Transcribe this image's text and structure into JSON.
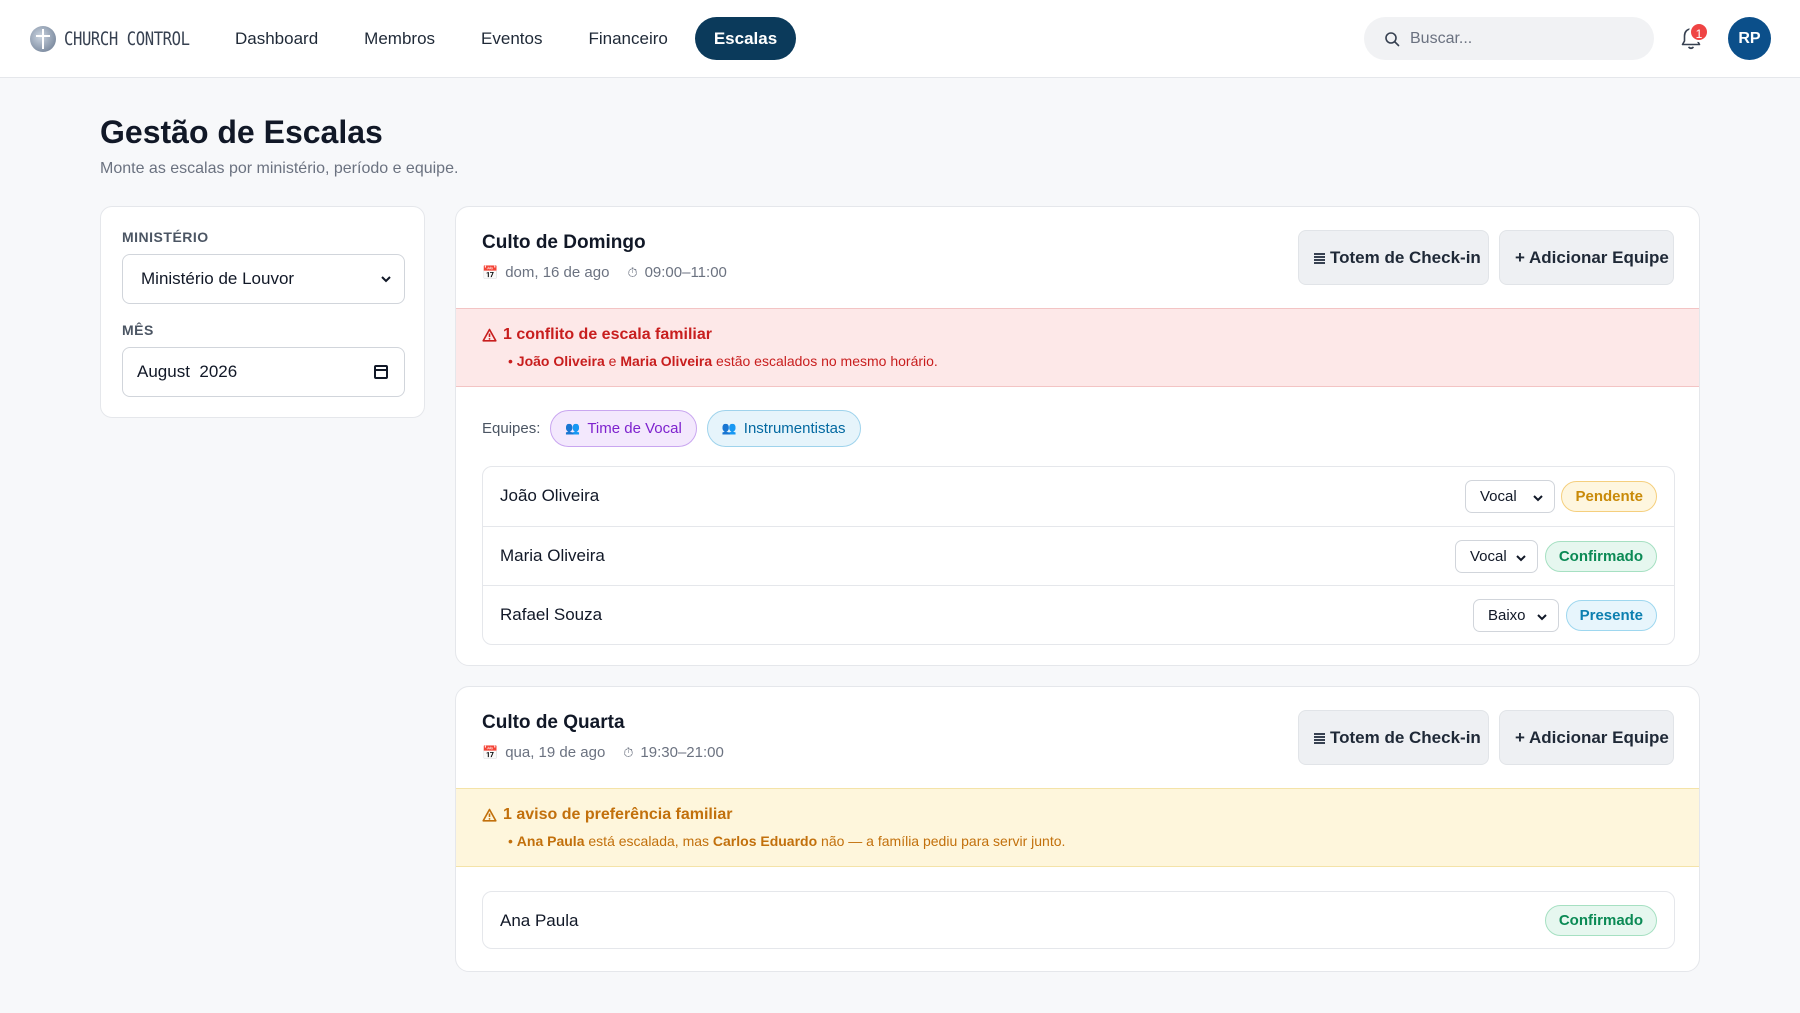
{
  "app": {
    "logo_text": "CHURCH CONTROL"
  },
  "nav": {
    "items": [
      {
        "label": "Dashboard"
      },
      {
        "label": "Membros"
      },
      {
        "label": "Eventos"
      },
      {
        "label": "Financeiro"
      },
      {
        "label": "Escalas",
        "active": true
      }
    ]
  },
  "search": {
    "placeholder": "Buscar..."
  },
  "notifications": {
    "count": "1"
  },
  "user": {
    "initials": "RP"
  },
  "page": {
    "title": "Gestão de Escalas",
    "subtitle": "Monte as escalas por ministério, período e equipe."
  },
  "filters": {
    "ministry_label": "MINISTÉRIO",
    "ministry_value": "Ministério de Louvor",
    "month_label": "MÊS",
    "month_value": "August  2026"
  },
  "buttons": {
    "totem": "Totem de Check-in",
    "add_team": "+ Adicionar Equipe"
  },
  "events": [
    {
      "title": "Culto de Domingo",
      "date": "dom, 16 de ago",
      "time": "09:00–11:00",
      "alert": {
        "type": "danger",
        "title": "1 conflito de escala familiar",
        "name1": "João Oliveira",
        "connector": "e",
        "name2": "Maria Oliveira",
        "rest": "estão escalados no mesmo horário."
      },
      "teams_label": "Equipes:",
      "teams": [
        {
          "label": "Time de Vocal"
        },
        {
          "label": "Instrumentistas"
        }
      ],
      "members": [
        {
          "name": "João Oliveira",
          "role": "Vocal",
          "status": "Pendente"
        },
        {
          "name": "Maria Oliveira",
          "role": "Vocal",
          "status": "Confirmado"
        },
        {
          "name": "Rafael Souza",
          "role": "Baixo",
          "status": "Presente"
        }
      ]
    },
    {
      "title": "Culto de Quarta",
      "date": "qua, 19 de ago",
      "time": "19:30–21:00",
      "alert": {
        "type": "warning",
        "title": "1 aviso de preferência familiar",
        "name1": "Ana Paula",
        "middle": "está escalada, mas",
        "name2": "Carlos Eduardo",
        "rest": "não — a família pediu para servir junto."
      },
      "members": [
        {
          "name": "Ana Paula",
          "status": "Confirmado"
        }
      ]
    }
  ],
  "colors": {
    "primary": "#0b3a5b",
    "danger": "#c81e1e",
    "warning": "#c2700c",
    "success": "#0b8a55",
    "info": "#0c7fb0",
    "pending": "#c98a08"
  }
}
